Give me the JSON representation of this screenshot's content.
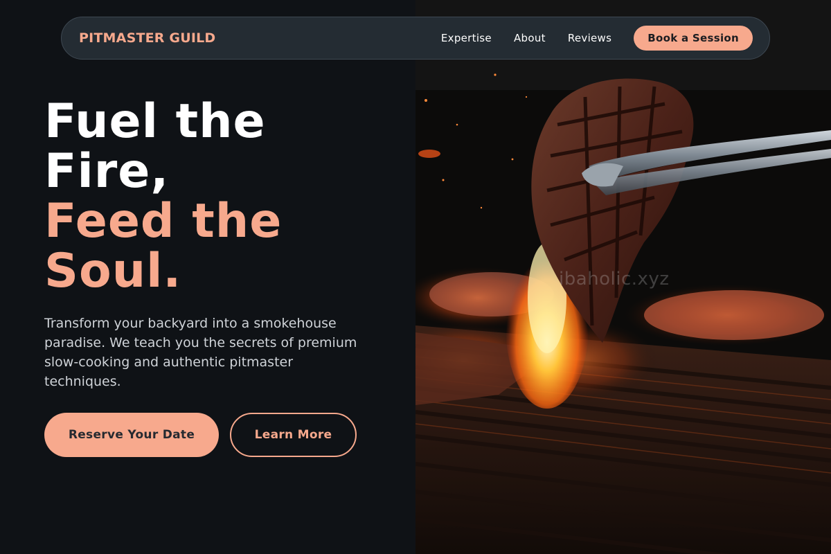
{
  "nav": {
    "brand": "PITMASTER GUILD",
    "links": [
      "Expertise",
      "About",
      "Reviews"
    ],
    "cta": "Book a Session"
  },
  "hero": {
    "headline_white_1": "Fuel the",
    "headline_white_2": "Fire,",
    "headline_accent_1": "Feed the",
    "headline_accent_2": "Soul.",
    "subtext": "Transform your backyard into a smokehouse paradise. We teach you the secrets of premium slow-cooking and authentic pitmaster techniques.",
    "primary_button": "Reserve Your Date",
    "secondary_button": "Learn More"
  },
  "image": {
    "subject": "steak held by tongs over flaming grill",
    "watermark": "ibaholic.xyz"
  },
  "colors": {
    "accent": "#f7a98d",
    "background": "#0f1216",
    "heading_white": "#ffffff",
    "nav_bg": "#262e36"
  }
}
